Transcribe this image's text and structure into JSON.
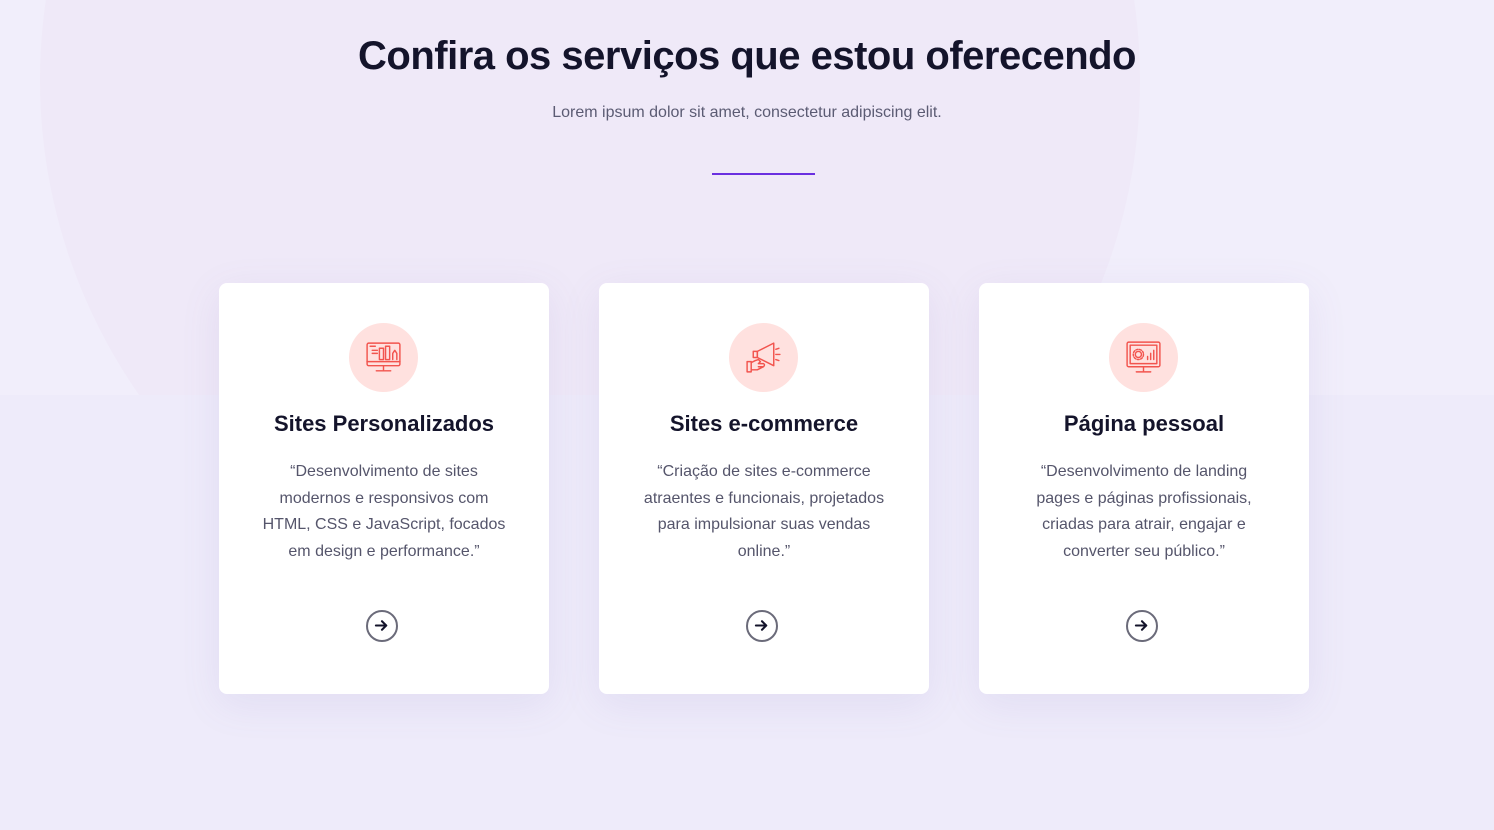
{
  "header": {
    "title": "Confira os serviços que estou oferecendo",
    "subtitle": "Lorem ipsum dolor sit amet, consectetur adipiscing elit."
  },
  "colors": {
    "accent": "#6a2fe0",
    "icon": "#f2544e",
    "icon_bg": "#ffe1df",
    "background": "#f1eefb"
  },
  "services": [
    {
      "icon": "web-design-monitor-icon",
      "title": "Sites Personalizados",
      "description": "“Desenvolvimento de sites modernos e responsivos com HTML, CSS e JavaScript, focados em design e performance.”",
      "action_icon": "arrow-right-icon"
    },
    {
      "icon": "megaphone-hand-icon",
      "title": "Sites e-commerce",
      "description": "“Criação de sites e-commerce atraentes e funcionais, projetados para impulsionar suas vendas online.”",
      "action_icon": "arrow-right-icon"
    },
    {
      "icon": "monitor-settings-chart-icon",
      "title": "Página pessoal",
      "description": "“Desenvolvimento de landing pages e páginas profissionais, criadas para atrair, engajar e converter seu público.”",
      "action_icon": "arrow-right-icon"
    }
  ]
}
